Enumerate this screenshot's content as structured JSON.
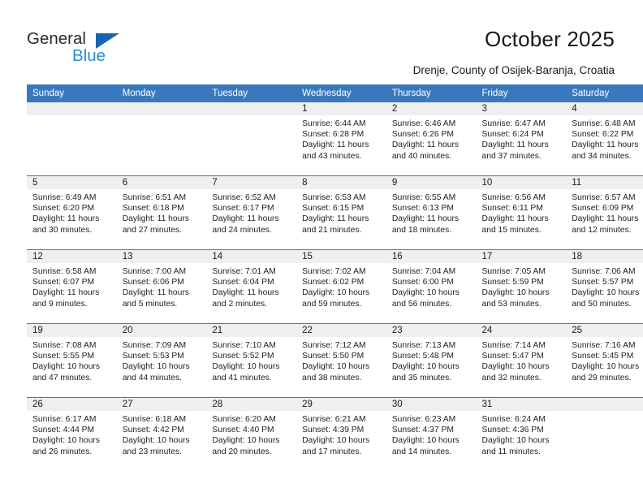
{
  "brand": {
    "name_part1": "General",
    "name_part2": "Blue"
  },
  "header": {
    "title": "October 2025",
    "subtitle": "Drenje, County of Osijek-Baranja, Croatia"
  },
  "calendar": {
    "weekday_headers": [
      "Sunday",
      "Monday",
      "Tuesday",
      "Wednesday",
      "Thursday",
      "Friday",
      "Saturday"
    ],
    "accent_color": "#3a78bd",
    "daynum_band_color": "#efefef",
    "weeks": [
      [
        {
          "day": "",
          "empty": true
        },
        {
          "day": "",
          "empty": true
        },
        {
          "day": "",
          "empty": true
        },
        {
          "day": "1",
          "sunrise": "Sunrise: 6:44 AM",
          "sunset": "Sunset: 6:28 PM",
          "daylight_line1": "Daylight: 11 hours",
          "daylight_line2": "and 43 minutes."
        },
        {
          "day": "2",
          "sunrise": "Sunrise: 6:46 AM",
          "sunset": "Sunset: 6:26 PM",
          "daylight_line1": "Daylight: 11 hours",
          "daylight_line2": "and 40 minutes."
        },
        {
          "day": "3",
          "sunrise": "Sunrise: 6:47 AM",
          "sunset": "Sunset: 6:24 PM",
          "daylight_line1": "Daylight: 11 hours",
          "daylight_line2": "and 37 minutes."
        },
        {
          "day": "4",
          "sunrise": "Sunrise: 6:48 AM",
          "sunset": "Sunset: 6:22 PM",
          "daylight_line1": "Daylight: 11 hours",
          "daylight_line2": "and 34 minutes."
        }
      ],
      [
        {
          "day": "5",
          "sunrise": "Sunrise: 6:49 AM",
          "sunset": "Sunset: 6:20 PM",
          "daylight_line1": "Daylight: 11 hours",
          "daylight_line2": "and 30 minutes."
        },
        {
          "day": "6",
          "sunrise": "Sunrise: 6:51 AM",
          "sunset": "Sunset: 6:18 PM",
          "daylight_line1": "Daylight: 11 hours",
          "daylight_line2": "and 27 minutes."
        },
        {
          "day": "7",
          "sunrise": "Sunrise: 6:52 AM",
          "sunset": "Sunset: 6:17 PM",
          "daylight_line1": "Daylight: 11 hours",
          "daylight_line2": "and 24 minutes."
        },
        {
          "day": "8",
          "sunrise": "Sunrise: 6:53 AM",
          "sunset": "Sunset: 6:15 PM",
          "daylight_line1": "Daylight: 11 hours",
          "daylight_line2": "and 21 minutes."
        },
        {
          "day": "9",
          "sunrise": "Sunrise: 6:55 AM",
          "sunset": "Sunset: 6:13 PM",
          "daylight_line1": "Daylight: 11 hours",
          "daylight_line2": "and 18 minutes."
        },
        {
          "day": "10",
          "sunrise": "Sunrise: 6:56 AM",
          "sunset": "Sunset: 6:11 PM",
          "daylight_line1": "Daylight: 11 hours",
          "daylight_line2": "and 15 minutes."
        },
        {
          "day": "11",
          "sunrise": "Sunrise: 6:57 AM",
          "sunset": "Sunset: 6:09 PM",
          "daylight_line1": "Daylight: 11 hours",
          "daylight_line2": "and 12 minutes."
        }
      ],
      [
        {
          "day": "12",
          "sunrise": "Sunrise: 6:58 AM",
          "sunset": "Sunset: 6:07 PM",
          "daylight_line1": "Daylight: 11 hours",
          "daylight_line2": "and 9 minutes."
        },
        {
          "day": "13",
          "sunrise": "Sunrise: 7:00 AM",
          "sunset": "Sunset: 6:06 PM",
          "daylight_line1": "Daylight: 11 hours",
          "daylight_line2": "and 5 minutes."
        },
        {
          "day": "14",
          "sunrise": "Sunrise: 7:01 AM",
          "sunset": "Sunset: 6:04 PM",
          "daylight_line1": "Daylight: 11 hours",
          "daylight_line2": "and 2 minutes."
        },
        {
          "day": "15",
          "sunrise": "Sunrise: 7:02 AM",
          "sunset": "Sunset: 6:02 PM",
          "daylight_line1": "Daylight: 10 hours",
          "daylight_line2": "and 59 minutes."
        },
        {
          "day": "16",
          "sunrise": "Sunrise: 7:04 AM",
          "sunset": "Sunset: 6:00 PM",
          "daylight_line1": "Daylight: 10 hours",
          "daylight_line2": "and 56 minutes."
        },
        {
          "day": "17",
          "sunrise": "Sunrise: 7:05 AM",
          "sunset": "Sunset: 5:59 PM",
          "daylight_line1": "Daylight: 10 hours",
          "daylight_line2": "and 53 minutes."
        },
        {
          "day": "18",
          "sunrise": "Sunrise: 7:06 AM",
          "sunset": "Sunset: 5:57 PM",
          "daylight_line1": "Daylight: 10 hours",
          "daylight_line2": "and 50 minutes."
        }
      ],
      [
        {
          "day": "19",
          "sunrise": "Sunrise: 7:08 AM",
          "sunset": "Sunset: 5:55 PM",
          "daylight_line1": "Daylight: 10 hours",
          "daylight_line2": "and 47 minutes."
        },
        {
          "day": "20",
          "sunrise": "Sunrise: 7:09 AM",
          "sunset": "Sunset: 5:53 PM",
          "daylight_line1": "Daylight: 10 hours",
          "daylight_line2": "and 44 minutes."
        },
        {
          "day": "21",
          "sunrise": "Sunrise: 7:10 AM",
          "sunset": "Sunset: 5:52 PM",
          "daylight_line1": "Daylight: 10 hours",
          "daylight_line2": "and 41 minutes."
        },
        {
          "day": "22",
          "sunrise": "Sunrise: 7:12 AM",
          "sunset": "Sunset: 5:50 PM",
          "daylight_line1": "Daylight: 10 hours",
          "daylight_line2": "and 38 minutes."
        },
        {
          "day": "23",
          "sunrise": "Sunrise: 7:13 AM",
          "sunset": "Sunset: 5:48 PM",
          "daylight_line1": "Daylight: 10 hours",
          "daylight_line2": "and 35 minutes."
        },
        {
          "day": "24",
          "sunrise": "Sunrise: 7:14 AM",
          "sunset": "Sunset: 5:47 PM",
          "daylight_line1": "Daylight: 10 hours",
          "daylight_line2": "and 32 minutes."
        },
        {
          "day": "25",
          "sunrise": "Sunrise: 7:16 AM",
          "sunset": "Sunset: 5:45 PM",
          "daylight_line1": "Daylight: 10 hours",
          "daylight_line2": "and 29 minutes."
        }
      ],
      [
        {
          "day": "26",
          "sunrise": "Sunrise: 6:17 AM",
          "sunset": "Sunset: 4:44 PM",
          "daylight_line1": "Daylight: 10 hours",
          "daylight_line2": "and 26 minutes."
        },
        {
          "day": "27",
          "sunrise": "Sunrise: 6:18 AM",
          "sunset": "Sunset: 4:42 PM",
          "daylight_line1": "Daylight: 10 hours",
          "daylight_line2": "and 23 minutes."
        },
        {
          "day": "28",
          "sunrise": "Sunrise: 6:20 AM",
          "sunset": "Sunset: 4:40 PM",
          "daylight_line1": "Daylight: 10 hours",
          "daylight_line2": "and 20 minutes."
        },
        {
          "day": "29",
          "sunrise": "Sunrise: 6:21 AM",
          "sunset": "Sunset: 4:39 PM",
          "daylight_line1": "Daylight: 10 hours",
          "daylight_line2": "and 17 minutes."
        },
        {
          "day": "30",
          "sunrise": "Sunrise: 6:23 AM",
          "sunset": "Sunset: 4:37 PM",
          "daylight_line1": "Daylight: 10 hours",
          "daylight_line2": "and 14 minutes."
        },
        {
          "day": "31",
          "sunrise": "Sunrise: 6:24 AM",
          "sunset": "Sunset: 4:36 PM",
          "daylight_line1": "Daylight: 10 hours",
          "daylight_line2": "and 11 minutes."
        },
        {
          "day": "",
          "empty": true
        }
      ]
    ]
  }
}
